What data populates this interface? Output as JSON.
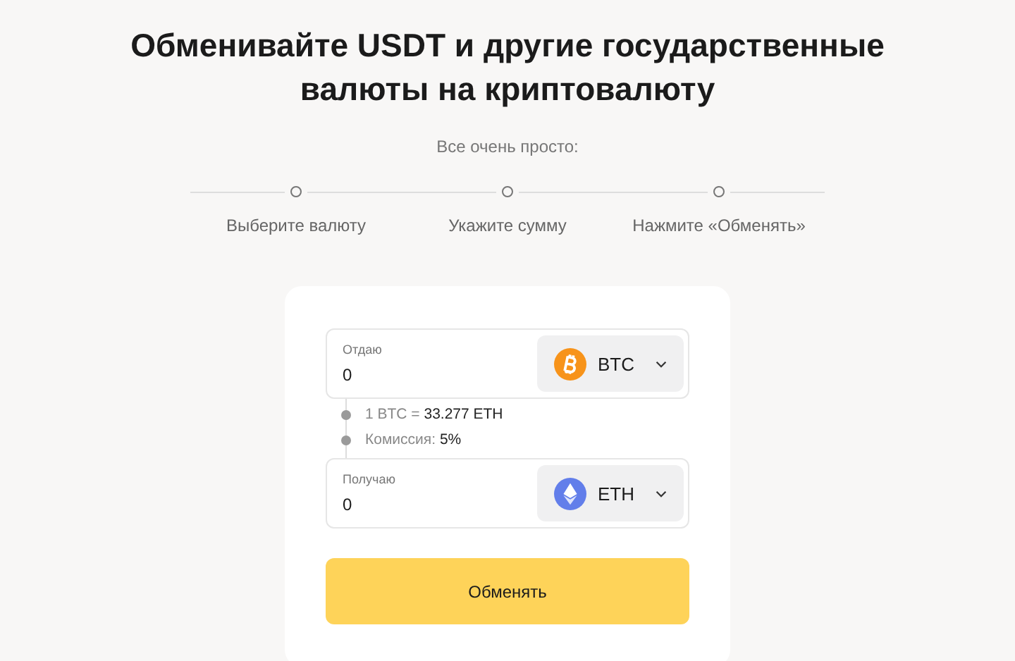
{
  "title": "Обменивайте USDT и другие государственные валюты на криптовалюту",
  "subtitle": "Все очень просто:",
  "steps": [
    "Выберите валюту",
    "Укажите сумму",
    "Нажмите «Обменять»"
  ],
  "give": {
    "label": "Отдаю",
    "value": "0",
    "currency": {
      "kind": "btc",
      "code": "BTC"
    }
  },
  "info": [
    "1 BTC = **33.277 ETH**",
    "Комиссия: **5%**"
  ],
  "receive": {
    "label": "Получаю",
    "value": "0",
    "currency": {
      "kind": "eth",
      "code": "ETH"
    }
  },
  "submit": "Обменять"
}
